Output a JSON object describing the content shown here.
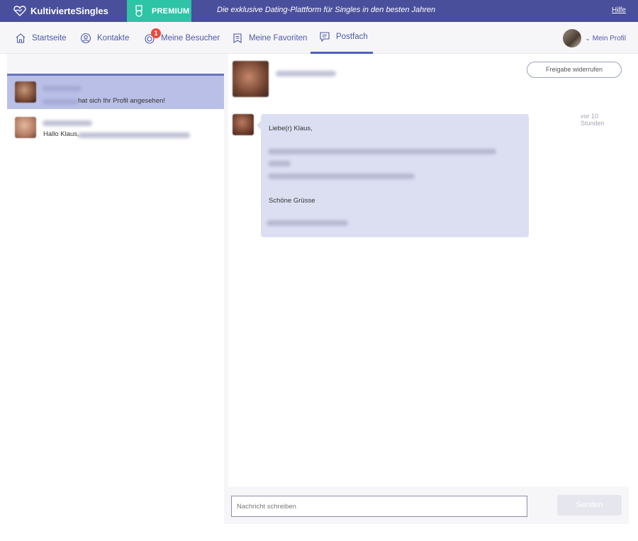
{
  "app": {
    "logo_text": "KultivierteSingles",
    "premium_label": "PREMIUM",
    "tagline": "Die exklusive Dating-Plattform für Singles in den besten Jahren",
    "help_label": "Hilfe"
  },
  "nav": {
    "items": [
      {
        "label": "Startseite",
        "icon": "home-icon"
      },
      {
        "label": "Kontakte",
        "icon": "user-circle-icon"
      },
      {
        "label": "Meine Besucher",
        "icon": "eye-icon",
        "badge": "1"
      },
      {
        "label": "Meine Favoriten",
        "icon": "bookmark-icon"
      },
      {
        "label": "Postfach",
        "icon": "message-icon",
        "active": true
      }
    ],
    "profile_label": "Mein Profil"
  },
  "conversations": [
    {
      "preview_suffix": "hat sich Ihr Profil angesehen!",
      "active": true
    },
    {
      "preview_prefix": "Hallo Klaus,",
      "active": false
    }
  ],
  "chat": {
    "revoke_label": "Freigabe widerrufen",
    "message": {
      "greeting": "Liebe(r) Klaus,",
      "closing": "Schöne Grüsse",
      "time": "vor 10 Stunden"
    },
    "composer": {
      "placeholder": "Nachricht schreiben",
      "send_label": "Senden"
    }
  },
  "colors": {
    "topbar": "#4a4f9c",
    "premium": "#2ec4a6",
    "accent": "#4d58a8",
    "bubble": "#dcdff2",
    "badge": "#e74c3c"
  }
}
